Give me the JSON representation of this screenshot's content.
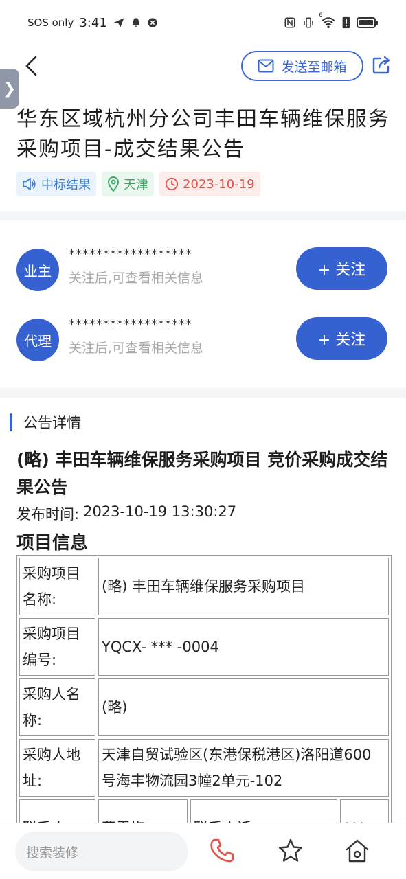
{
  "status_bar": {
    "sos": "SOS only",
    "time": "3:41",
    "network_label": "6"
  },
  "nav": {
    "mail_label": "发送至邮箱"
  },
  "side_tab": {
    "glyph": "❯"
  },
  "title": "华东区域杭州分公司丰田车辆维保服务采购项目-成交结果公告",
  "tags": [
    {
      "label": "中标结果",
      "icon": "speaker-icon",
      "color": "#3d7fd0"
    },
    {
      "label": "天津",
      "icon": "location-pin-icon",
      "color": "#3faa68"
    },
    {
      "label": "2023-10-19",
      "icon": "clock-icon",
      "color": "#e0534a"
    }
  ],
  "parties": [
    {
      "avatar": "业主",
      "mask": "******************",
      "hint": "关注后,可查看相关信息",
      "follow_label": "+ 关注"
    },
    {
      "avatar": "代理",
      "mask": "******************",
      "hint": "关注后,可查看相关信息",
      "follow_label": "+ 关注"
    }
  ],
  "section": {
    "label": "公告详情"
  },
  "notice": {
    "title": "(略) 丰田车辆维保服务采购项目 竞价采购成交结果公告",
    "publish_label": "发布时间:",
    "publish_time": "2023-10-19 13:30:27",
    "project_heading": "项目信息"
  },
  "info_table": {
    "rows": [
      {
        "label": "采购项目名称:",
        "value": "(略) 丰田车辆维保服务采购项目"
      },
      {
        "label": "采购项目编号:",
        "value": "YQCX- *** -0004"
      },
      {
        "label": "采购人名称:",
        "value": "(略)"
      },
      {
        "label": "采购人地址:",
        "value": "天津自贸试验区(东港保税港区)洛阳道600号海丰物流园3幢2单元-102"
      }
    ],
    "partial_row": {
      "label": "联系人:",
      "value": "曹雪梅",
      "label2": "联系电话:",
      "value2": "***"
    }
  },
  "bottom_bar": {
    "search_placeholder": "搜索装修",
    "accent": "#3661d1",
    "phone_color": "#e0534a"
  }
}
